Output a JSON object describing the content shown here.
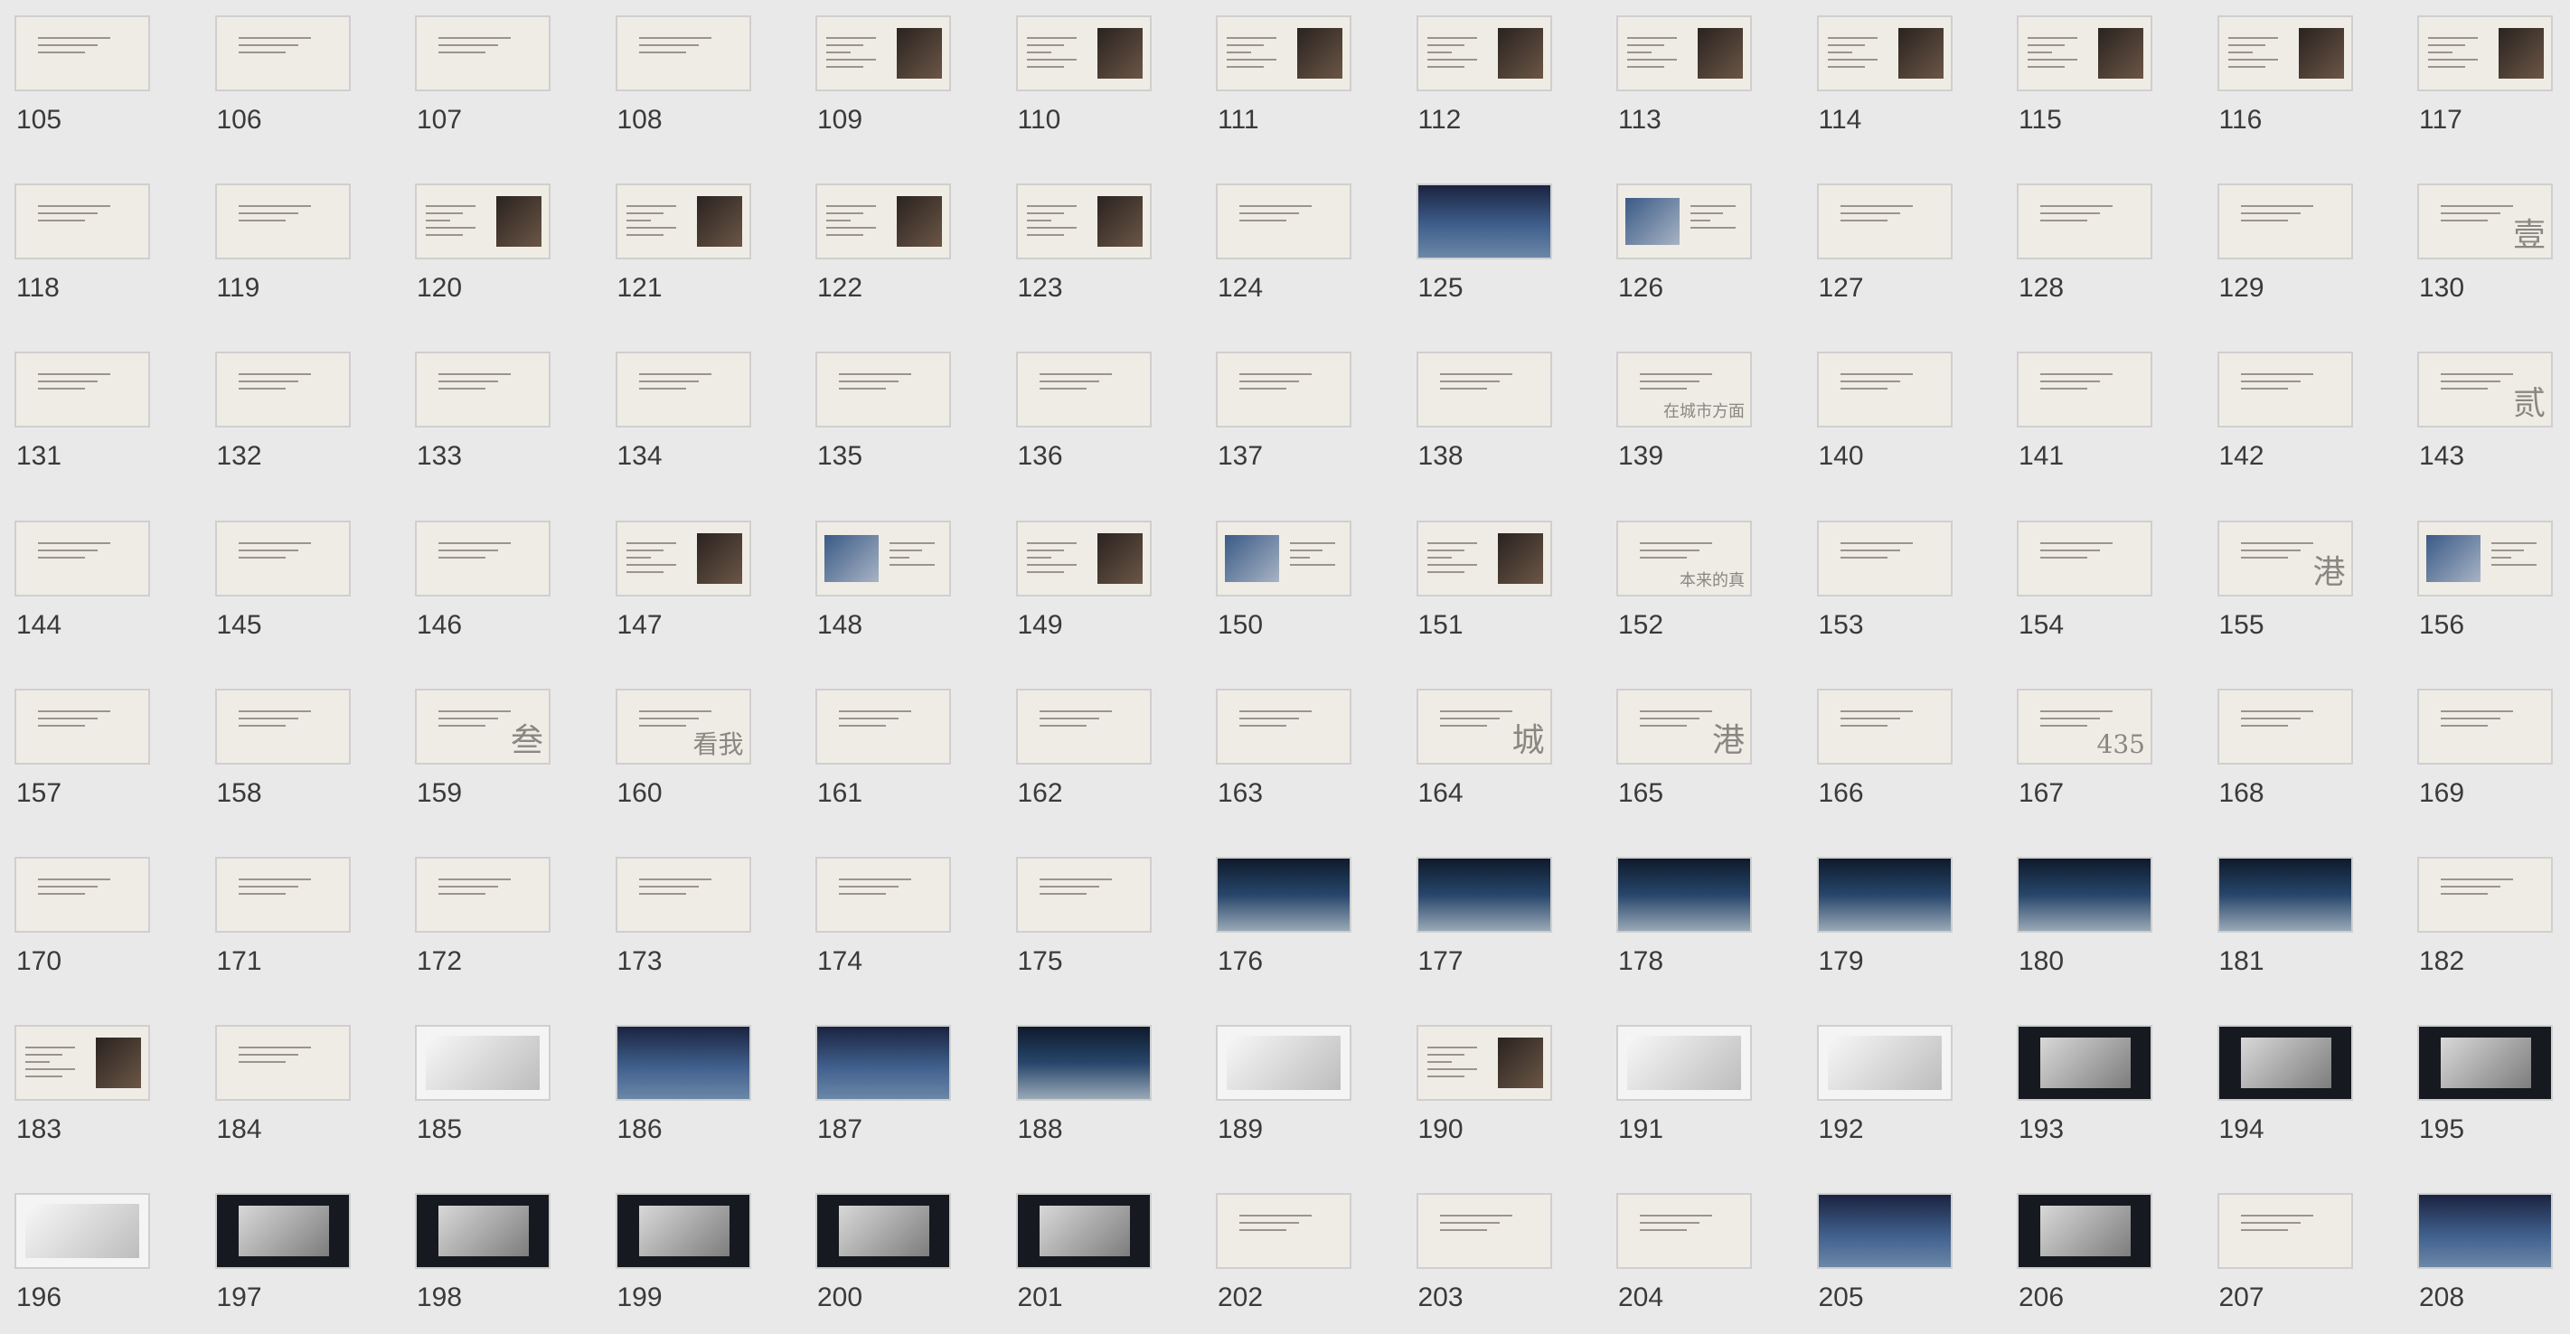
{
  "slides": [
    {
      "num": "105",
      "style": "text"
    },
    {
      "num": "106",
      "style": "text"
    },
    {
      "num": "107",
      "style": "text"
    },
    {
      "num": "108",
      "style": "text"
    },
    {
      "num": "109",
      "style": "text-photo-r"
    },
    {
      "num": "110",
      "style": "text-photo-r"
    },
    {
      "num": "111",
      "style": "text-photo-r"
    },
    {
      "num": "112",
      "style": "text-photo-r"
    },
    {
      "num": "113",
      "style": "text-photo-r"
    },
    {
      "num": "114",
      "style": "text-photo-r"
    },
    {
      "num": "115",
      "style": "text-photo-r"
    },
    {
      "num": "116",
      "style": "text-photo-r"
    },
    {
      "num": "117",
      "style": "text-photo-r"
    },
    {
      "num": "118",
      "style": "text"
    },
    {
      "num": "119",
      "style": "text"
    },
    {
      "num": "120",
      "style": "text-photo-r"
    },
    {
      "num": "121",
      "style": "text-photo-r"
    },
    {
      "num": "122",
      "style": "text-photo-r"
    },
    {
      "num": "123",
      "style": "text-photo-r"
    },
    {
      "num": "124",
      "style": "text"
    },
    {
      "num": "125",
      "style": "photo-full"
    },
    {
      "num": "126",
      "style": "text-photo-l"
    },
    {
      "num": "127",
      "style": "text"
    },
    {
      "num": "128",
      "style": "text"
    },
    {
      "num": "129",
      "style": "text"
    },
    {
      "num": "130",
      "style": "text"
    },
    {
      "num": "131",
      "style": "text"
    },
    {
      "num": "132",
      "style": "text"
    },
    {
      "num": "133",
      "style": "text"
    },
    {
      "num": "134",
      "style": "text"
    },
    {
      "num": "135",
      "style": "text"
    },
    {
      "num": "136",
      "style": "text"
    },
    {
      "num": "137",
      "style": "text"
    },
    {
      "num": "138",
      "style": "text"
    },
    {
      "num": "139",
      "style": "text"
    },
    {
      "num": "140",
      "style": "text"
    },
    {
      "num": "141",
      "style": "text"
    },
    {
      "num": "142",
      "style": "text"
    },
    {
      "num": "143",
      "style": "text"
    },
    {
      "num": "144",
      "style": "text"
    },
    {
      "num": "145",
      "style": "text"
    },
    {
      "num": "146",
      "style": "text"
    },
    {
      "num": "147",
      "style": "text-photo-r"
    },
    {
      "num": "148",
      "style": "text-photo-l"
    },
    {
      "num": "149",
      "style": "text-photo-r"
    },
    {
      "num": "150",
      "style": "text-photo-l"
    },
    {
      "num": "151",
      "style": "text-photo-r"
    },
    {
      "num": "152",
      "style": "text"
    },
    {
      "num": "153",
      "style": "text"
    },
    {
      "num": "154",
      "style": "text"
    },
    {
      "num": "155",
      "style": "text"
    },
    {
      "num": "156",
      "style": "text-photo-l"
    },
    {
      "num": "157",
      "style": "text"
    },
    {
      "num": "158",
      "style": "text"
    },
    {
      "num": "159",
      "style": "text"
    },
    {
      "num": "160",
      "style": "text"
    },
    {
      "num": "161",
      "style": "text"
    },
    {
      "num": "162",
      "style": "text"
    },
    {
      "num": "163",
      "style": "text"
    },
    {
      "num": "164",
      "style": "text"
    },
    {
      "num": "165",
      "style": "text"
    },
    {
      "num": "166",
      "style": "text"
    },
    {
      "num": "167",
      "style": "text"
    },
    {
      "num": "168",
      "style": "text"
    },
    {
      "num": "169",
      "style": "text"
    },
    {
      "num": "170",
      "style": "text"
    },
    {
      "num": "171",
      "style": "text"
    },
    {
      "num": "172",
      "style": "text"
    },
    {
      "num": "173",
      "style": "text"
    },
    {
      "num": "174",
      "style": "text"
    },
    {
      "num": "175",
      "style": "text"
    },
    {
      "num": "176",
      "style": "photo-band"
    },
    {
      "num": "177",
      "style": "photo-band"
    },
    {
      "num": "178",
      "style": "photo-band"
    },
    {
      "num": "179",
      "style": "photo-band"
    },
    {
      "num": "180",
      "style": "photo-band"
    },
    {
      "num": "181",
      "style": "photo-band"
    },
    {
      "num": "182",
      "style": "text"
    },
    {
      "num": "183",
      "style": "text-photo-r"
    },
    {
      "num": "184",
      "style": "text"
    },
    {
      "num": "185",
      "style": "white"
    },
    {
      "num": "186",
      "style": "photo-full"
    },
    {
      "num": "187",
      "style": "photo-full"
    },
    {
      "num": "188",
      "style": "photo-band"
    },
    {
      "num": "189",
      "style": "white"
    },
    {
      "num": "190",
      "style": "text-photo-r"
    },
    {
      "num": "191",
      "style": "white"
    },
    {
      "num": "192",
      "style": "white"
    },
    {
      "num": "193",
      "style": "dark"
    },
    {
      "num": "194",
      "style": "dark"
    },
    {
      "num": "195",
      "style": "dark"
    },
    {
      "num": "196",
      "style": "white"
    },
    {
      "num": "197",
      "style": "dark"
    },
    {
      "num": "198",
      "style": "dark"
    },
    {
      "num": "199",
      "style": "dark"
    },
    {
      "num": "200",
      "style": "dark"
    },
    {
      "num": "201",
      "style": "dark"
    },
    {
      "num": "202",
      "style": "text"
    },
    {
      "num": "203",
      "style": "text"
    },
    {
      "num": "204",
      "style": "text"
    },
    {
      "num": "205",
      "style": "photo-full"
    },
    {
      "num": "206",
      "style": "dark"
    },
    {
      "num": "207",
      "style": "text"
    },
    {
      "num": "208",
      "style": "photo-full"
    }
  ],
  "big_chars": {
    "130": "壹",
    "143": "贰",
    "159": "叁",
    "160": "看我",
    "164": "城",
    "165": "港",
    "155": "港",
    "167": "435",
    "139": "在城市方面",
    "152": "本来的真"
  },
  "colors": {
    "background": "#e9e9e9",
    "slide_paper": "#efece6",
    "slide_border": "#cfcfcf",
    "dark_slide": "#161a20"
  }
}
